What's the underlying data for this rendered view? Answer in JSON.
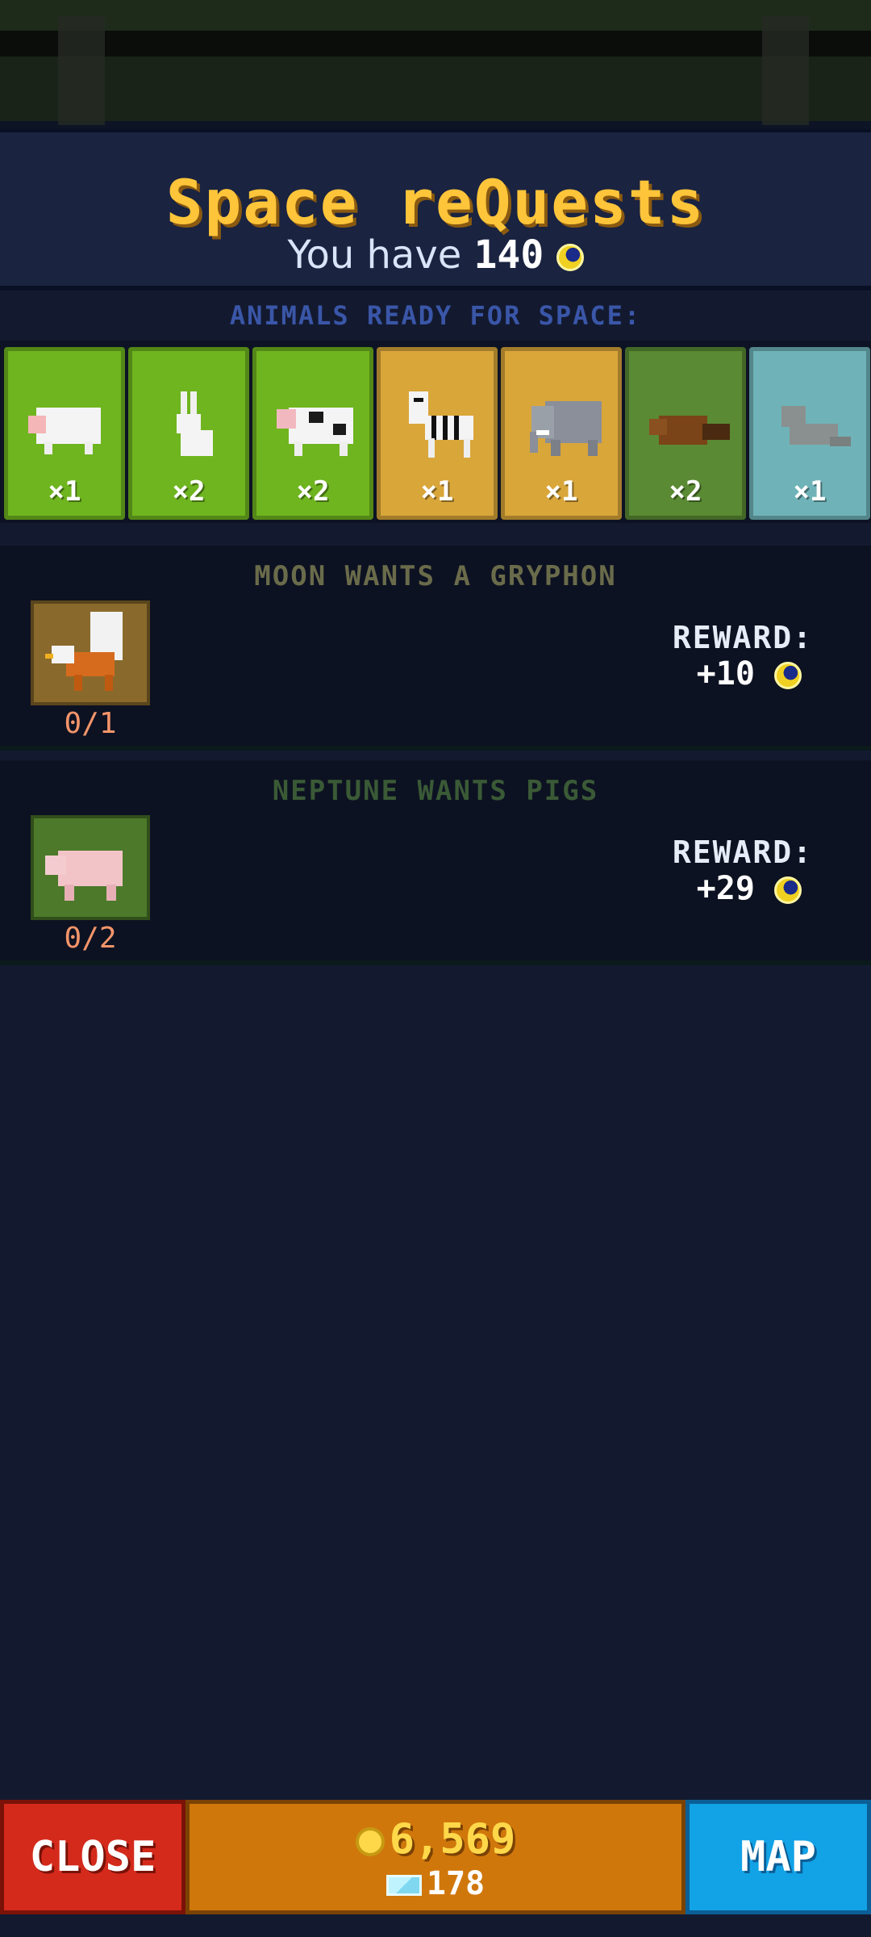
{
  "header": {
    "title": "Space reQuests",
    "have_prefix": "You have",
    "have_amount": "140"
  },
  "animals_section": {
    "label": "ANIMALS READY FOR SPACE:",
    "cards": [
      {
        "animal": "sheep-icon",
        "qty": "×1",
        "color": "#6fb51f"
      },
      {
        "animal": "rabbit-icon",
        "qty": "×2",
        "color": "#6fb51f"
      },
      {
        "animal": "cow-icon",
        "qty": "×2",
        "color": "#6fb51f"
      },
      {
        "animal": "zebra-icon",
        "qty": "×1",
        "color": "#d9a63a"
      },
      {
        "animal": "elephant-icon",
        "qty": "×1",
        "color": "#d9a63a"
      },
      {
        "animal": "beaver-icon",
        "qty": "×2",
        "color": "#5a8a33"
      },
      {
        "animal": "seal-icon",
        "qty": "×1",
        "color": "#6fb3b8"
      }
    ]
  },
  "quests": [
    {
      "title": "MOON WANTS A GRYPHON",
      "title_color": "#6a6b4a",
      "icon": "gryphon-icon",
      "icon_bg": "#8a6a2c",
      "progress": "0/1",
      "reward_label": "REWARD:",
      "reward_value": "+10"
    },
    {
      "title": "NEPTUNE WANTS PIGS",
      "title_color": "#3a5a36",
      "icon": "pig-icon",
      "icon_bg": "#4c7a2a",
      "progress": "0/2",
      "reward_label": "REWARD:",
      "reward_value": "+29"
    }
  ],
  "footer": {
    "close_label": "CLOSE",
    "gold": "6,569",
    "gems": "178",
    "map_label": "MAP"
  }
}
